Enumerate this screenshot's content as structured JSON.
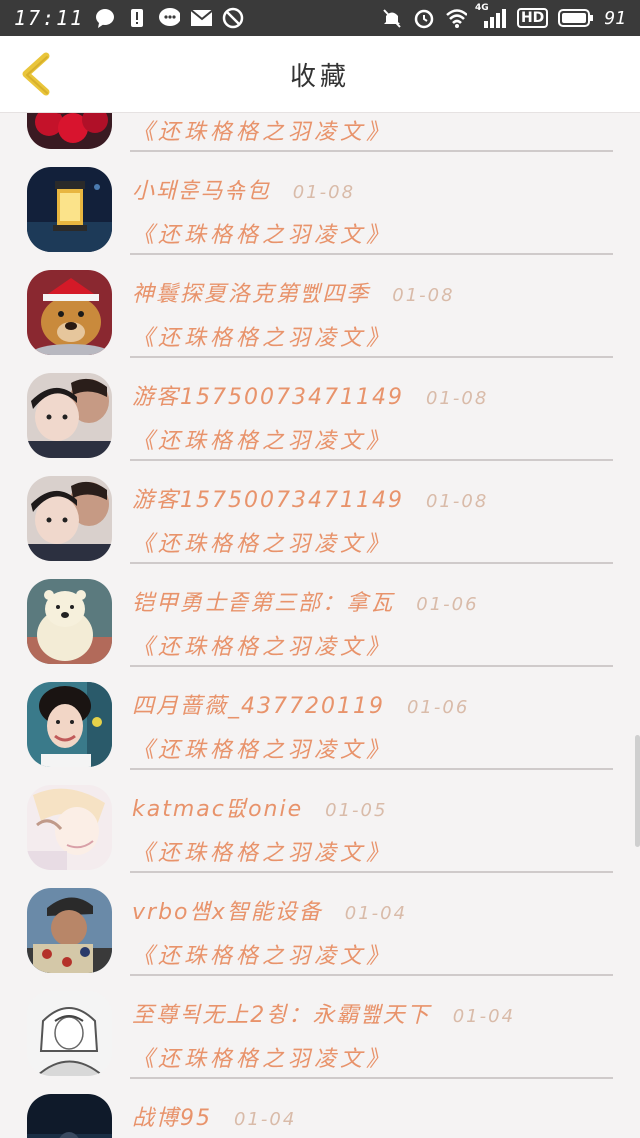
{
  "status_bar": {
    "time": "17:11",
    "network_label": "4G",
    "hd_label": "HD",
    "battery_percent": "91"
  },
  "nav": {
    "title": "收藏"
  },
  "colors": {
    "accent": "#e8936b",
    "date": "#d9bba9",
    "back_icon": "#e9c53a"
  },
  "items": [
    {
      "name": "",
      "date": "",
      "work": "《还珠格格之羽凌文》",
      "avatar": "roses-avatar"
    },
    {
      "name": "小돼훈马쇾包",
      "date": "01-08",
      "work": "《还珠格格之羽凌文》",
      "avatar": "lantern-avatar"
    },
    {
      "name": "神鬟探夏洛克第뻸四季",
      "date": "01-08",
      "work": "《还珠格格之羽凌文》",
      "avatar": "dog-avatar"
    },
    {
      "name": "游客15750073471149",
      "date": "01-08",
      "work": "《还珠格格之羽凌文》",
      "avatar": "couple-avatar"
    },
    {
      "name": "游客15750073471149",
      "date": "01-08",
      "work": "《还珠格格之羽凌文》",
      "avatar": "couple-avatar"
    },
    {
      "name": "铠甲勇士좉第三部：拿瓦",
      "date": "01-06",
      "work": "《还珠格格之羽凌文》",
      "avatar": "bear-avatar"
    },
    {
      "name": "四月蔷薇_437720119",
      "date": "01-06",
      "work": "《还珠格格之羽凌文》",
      "avatar": "woman-avatar"
    },
    {
      "name": "katmac떲onie",
      "date": "01-05",
      "work": "《还珠格格之羽凌文》",
      "avatar": "anime-avatar"
    },
    {
      "name": "vrbo썜x智能设备",
      "date": "01-04",
      "work": "《还珠格格之羽凌文》",
      "avatar": "man-avatar"
    },
    {
      "name": "至尊됙无上2췽：永霸뾆天下",
      "date": "01-04",
      "work": "《还珠格格之羽凌文》",
      "avatar": "sketch-avatar"
    },
    {
      "name": "战博95",
      "date": "01-04",
      "work": "",
      "avatar": "night-avatar"
    }
  ]
}
